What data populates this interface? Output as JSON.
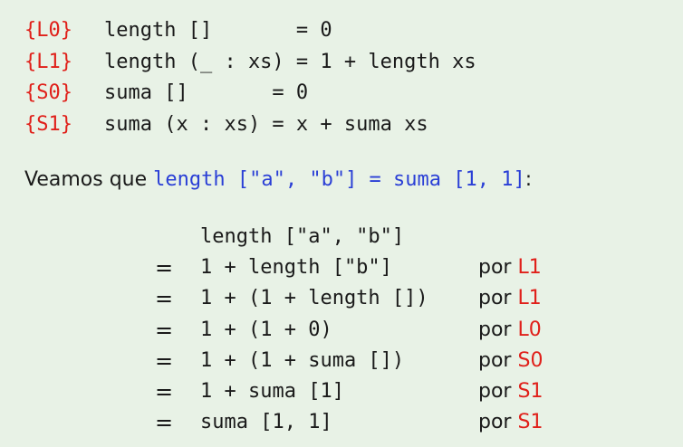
{
  "definitions": [
    {
      "tag": "{L0}",
      "code": "length []       = 0"
    },
    {
      "tag": "{L1}",
      "code": "length (_ : xs) = 1 + length xs"
    },
    {
      "tag": "{S0}",
      "code": "suma []       = 0"
    },
    {
      "tag": "{S1}",
      "code": "suma (x : xs) = x + suma xs"
    }
  ],
  "intro": {
    "prefix": "Veamos que ",
    "code": "length [\"a\", \"b\"] = suma [1, 1]",
    "suffix": ":"
  },
  "derivation": {
    "start": "length [\"a\", \"b\"]",
    "eq_symbol": "=",
    "by_word": "por",
    "steps": [
      {
        "expr": "1 + length [\"b\"]",
        "ref": "L1"
      },
      {
        "expr": "1 + (1 + length [])",
        "ref": "L1"
      },
      {
        "expr": "1 + (1 + 0)",
        "ref": "L0"
      },
      {
        "expr": "1 + (1 + suma [])",
        "ref": "S0"
      },
      {
        "expr": "1 + suma [1]",
        "ref": "S1"
      },
      {
        "expr": "suma [1, 1]",
        "ref": "S1"
      }
    ]
  },
  "colors": {
    "background": "#e8f2e6",
    "reference_red": "#e0201a",
    "inline_code_blue": "#2a3fd6"
  }
}
